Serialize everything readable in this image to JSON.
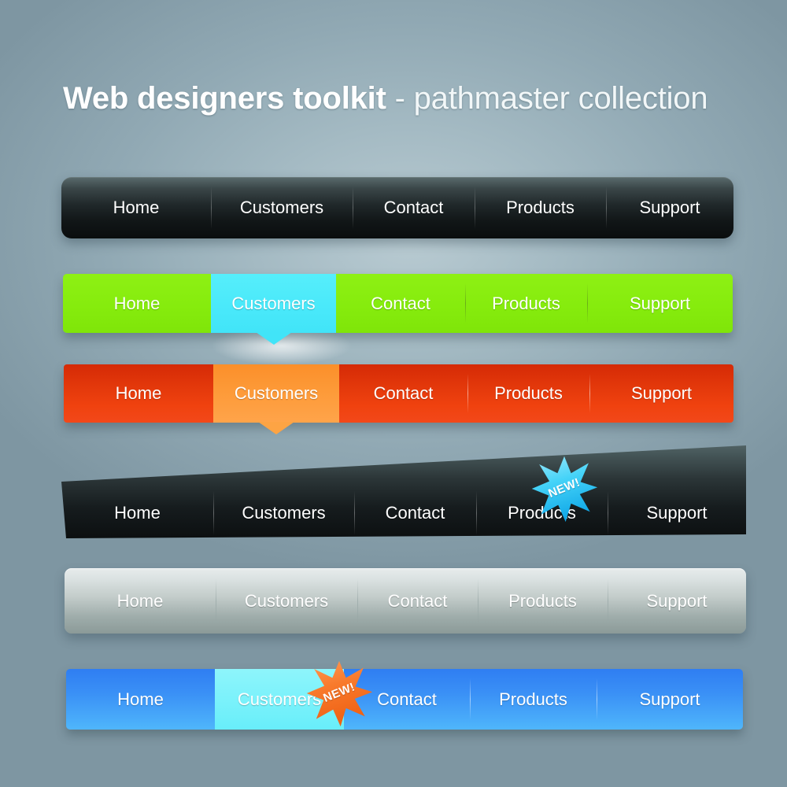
{
  "header": {
    "title_bold": "Web designers toolkit",
    "title_rest": " - pathmaster collection"
  },
  "menu_items": [
    "Home",
    "Customers",
    "Contact",
    "Products",
    "Support"
  ],
  "badges": {
    "new_label": "NEW!",
    "blue_badge_color": "#3fd2f7",
    "orange_badge_color": "#f4772a"
  },
  "bars": [
    {
      "id": "bar-dark-rounded",
      "style_name": "dark-rounded",
      "accent": "#20282a",
      "active_index": -1,
      "items": [
        "Home",
        "Customers",
        "Contact",
        "Products",
        "Support"
      ]
    },
    {
      "id": "bar-green",
      "style_name": "green-flat",
      "accent": "#86ec0d",
      "active_color": "#4ae9fa",
      "active_index": 1,
      "items": [
        "Home",
        "Customers",
        "Contact",
        "Products",
        "Support"
      ]
    },
    {
      "id": "bar-red",
      "style_name": "red-flat",
      "accent": "#e3380b",
      "active_color": "#fd9a38",
      "active_index": 1,
      "items": [
        "Home",
        "Customers",
        "Contact",
        "Products",
        "Support"
      ]
    },
    {
      "id": "bar-dark-slanted",
      "style_name": "dark-slanted",
      "accent": "#2b3537",
      "active_index": -1,
      "badge_on": "Products",
      "items": [
        "Home",
        "Customers",
        "Contact",
        "Products",
        "Support"
      ]
    },
    {
      "id": "bar-silver",
      "style_name": "silver-rounded",
      "accent": "#c3ccca",
      "active_index": -1,
      "items": [
        "Home",
        "Customers",
        "Contact",
        "Products",
        "Support"
      ]
    },
    {
      "id": "bar-blue",
      "style_name": "blue-flat",
      "accent": "#3a90f6",
      "active_color": "#7df2fb",
      "active_index": 1,
      "badge_on": "Customers",
      "items": [
        "Home",
        "Customers",
        "Contact",
        "Products",
        "Support"
      ]
    }
  ]
}
